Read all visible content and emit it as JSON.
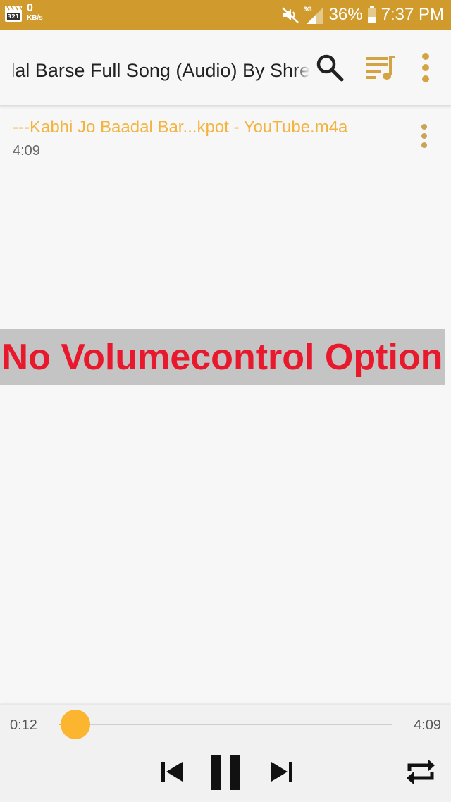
{
  "status_bar": {
    "app_icon": "video-player-app-icon",
    "net_speed_value": "0",
    "net_speed_unit": "KB/s",
    "network_type": "3G",
    "battery": "36%",
    "time": "7:37 PM",
    "icons": [
      "mute-icon",
      "signal-icon",
      "battery-icon"
    ]
  },
  "toolbar": {
    "title": "Kabhi Jo Baadal Barse Full Song (Audio) By Shre",
    "icons": [
      "search-icon",
      "playlist-icon",
      "more-vert-icon"
    ],
    "accent_color": "#d09b2c"
  },
  "track_list": [
    {
      "title": "---Kabhi Jo Baadal Bar...kpot - YouTube.m4a",
      "duration": "4:09"
    }
  ],
  "annotation": {
    "text": "No Volumecontrol Option",
    "color": "#e8192c",
    "background": "#c4c4c4"
  },
  "player": {
    "elapsed": "0:12",
    "total": "4:09",
    "progress_fraction": 0.049,
    "controls": [
      "skip-previous-icon",
      "pause-icon",
      "skip-next-icon",
      "repeat-icon"
    ],
    "thumb_color": "#fbb52e"
  }
}
